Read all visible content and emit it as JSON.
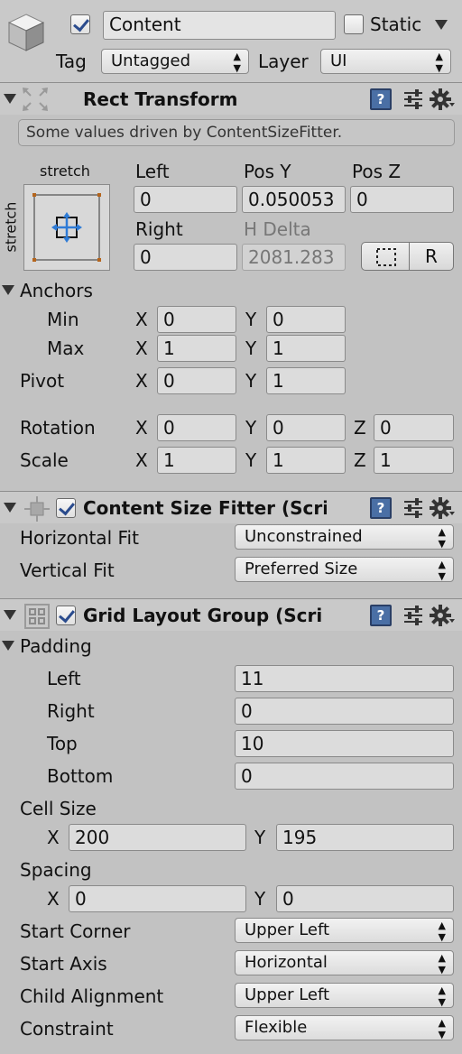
{
  "object": {
    "name": "Content",
    "active": true,
    "static_label": "Static",
    "static": false,
    "tag_label": "Tag",
    "tag_value": "Untagged",
    "layer_label": "Layer",
    "layer_value": "UI"
  },
  "rect_transform": {
    "title": "Rect Transform",
    "info": "Some values driven by ContentSizeFitter.",
    "anchor_preset_top": "stretch",
    "anchor_preset_side": "stretch",
    "left_label": "Left",
    "left_value": "0",
    "posy_label": "Pos Y",
    "posy_value": "0.050053",
    "posz_label": "Pos Z",
    "posz_value": "0",
    "right_label": "Right",
    "right_value": "0",
    "hdelta_label": "H Delta",
    "hdelta_value": "2081.283",
    "r_button": "R",
    "anchors_label": "Anchors",
    "min_label": "Min",
    "min_x": "0",
    "min_y": "0",
    "max_label": "Max",
    "max_x": "1",
    "max_y": "1",
    "pivot_label": "Pivot",
    "pivot_x": "0",
    "pivot_y": "1",
    "rotation_label": "Rotation",
    "rot_x": "0",
    "rot_y": "0",
    "rot_z": "0",
    "scale_label": "Scale",
    "scale_x": "1",
    "scale_y": "1",
    "scale_z": "1",
    "x": "X",
    "y": "Y",
    "z": "Z"
  },
  "content_size_fitter": {
    "title": "Content Size Fitter (Scri",
    "enabled": true,
    "horizontal_label": "Horizontal Fit",
    "horizontal_value": "Unconstrained",
    "vertical_label": "Vertical Fit",
    "vertical_value": "Preferred Size"
  },
  "grid_layout": {
    "title": "Grid Layout Group (Scri",
    "enabled": true,
    "padding_label": "Padding",
    "left_label": "Left",
    "left_value": "11",
    "right_label": "Right",
    "right_value": "0",
    "top_label": "Top",
    "top_value": "10",
    "bottom_label": "Bottom",
    "bottom_value": "0",
    "cell_size_label": "Cell Size",
    "cell_x": "200",
    "cell_y": "195",
    "spacing_label": "Spacing",
    "spacing_x": "0",
    "spacing_y": "0",
    "start_corner_label": "Start Corner",
    "start_corner_value": "Upper Left",
    "start_axis_label": "Start Axis",
    "start_axis_value": "Horizontal",
    "child_alignment_label": "Child Alignment",
    "child_alignment_value": "Upper Left",
    "constraint_label": "Constraint",
    "constraint_value": "Flexible"
  }
}
